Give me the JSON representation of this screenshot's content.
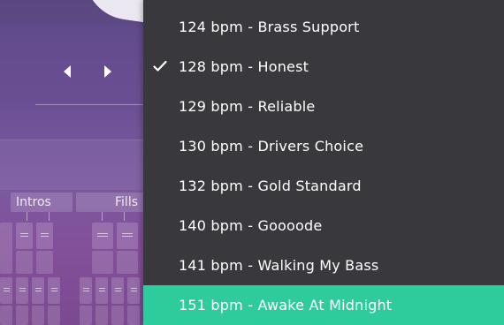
{
  "background_panel": {
    "tabs": [
      {
        "label": "Intros"
      },
      {
        "label": "Fills"
      }
    ]
  },
  "tempo_menu": {
    "items": [
      {
        "label": "124 bpm - Brass Support",
        "checked": false,
        "highlighted": false
      },
      {
        "label": "128 bpm - Honest",
        "checked": true,
        "highlighted": false
      },
      {
        "label": "129 bpm - Reliable",
        "checked": false,
        "highlighted": false
      },
      {
        "label": "130 bpm - Drivers Choice",
        "checked": false,
        "highlighted": false
      },
      {
        "label": "132 bpm - Gold Standard",
        "checked": false,
        "highlighted": false
      },
      {
        "label": "140 bpm - Goooode",
        "checked": false,
        "highlighted": false
      },
      {
        "label": "141 bpm - Walking My Bass",
        "checked": false,
        "highlighted": false
      },
      {
        "label": "151 bpm - Awake At Midnight",
        "checked": false,
        "highlighted": true
      }
    ],
    "icons": {
      "checked_item": "checkmark-icon"
    }
  },
  "colors": {
    "menu_background": "#39393d",
    "highlight": "#2ecc9c",
    "text": "#ffffff",
    "panel_purple": "#6a4e93"
  }
}
